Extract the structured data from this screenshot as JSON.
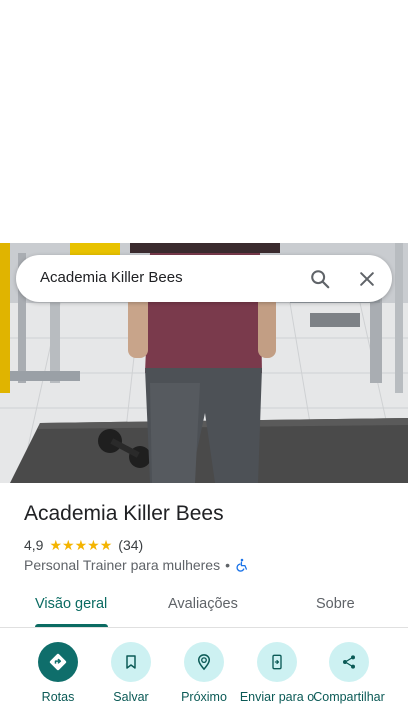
{
  "search": {
    "query": "Academia Killer Bees",
    "search_icon": "search-icon",
    "close_icon": "close-icon"
  },
  "place": {
    "name": "Academia Killer Bees",
    "rating": "4,9",
    "stars": 5,
    "review_count": "(34)",
    "category": "Personal Trainer para mulheres",
    "separator": "•",
    "accessibility_icon": "wheelchair-icon"
  },
  "tabs": [
    {
      "label": "Visão geral",
      "active": true
    },
    {
      "label": "Avaliações",
      "active": false
    },
    {
      "label": "Sobre",
      "active": false
    }
  ],
  "actions": [
    {
      "label": "Rotas",
      "icon": "directions-icon"
    },
    {
      "label": "Salvar",
      "icon": "bookmark-icon"
    },
    {
      "label": "Próximo",
      "icon": "nearby-icon"
    },
    {
      "label": "Enviar para o",
      "icon": "send-to-phone-icon"
    },
    {
      "label": "Compartilhar",
      "icon": "share-icon"
    }
  ],
  "colors": {
    "accent": "#0b6b62",
    "star": "#f4b400",
    "action_bg": "#cdf1f2",
    "primary_action_bg": "#0f6e6b",
    "accessibility_icon": "#1a73e8"
  }
}
